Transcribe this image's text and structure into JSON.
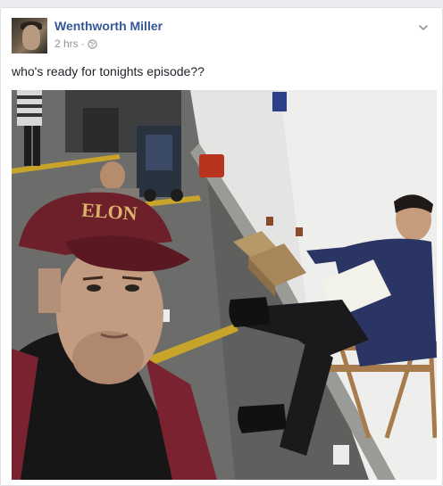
{
  "post": {
    "author": "Wenthworth Miller",
    "time": "2 hrs",
    "separator": "·",
    "text": "who's ready for tonights episode??",
    "audience_icon": "globe-icon",
    "menu_icon": "chevron-down-icon"
  },
  "photo": {
    "cap_text": "ELON"
  },
  "colors": {
    "author_link": "#365899",
    "meta_gray": "#90949c",
    "body_text": "#1d2129",
    "page_bg": "#e9ebee"
  }
}
